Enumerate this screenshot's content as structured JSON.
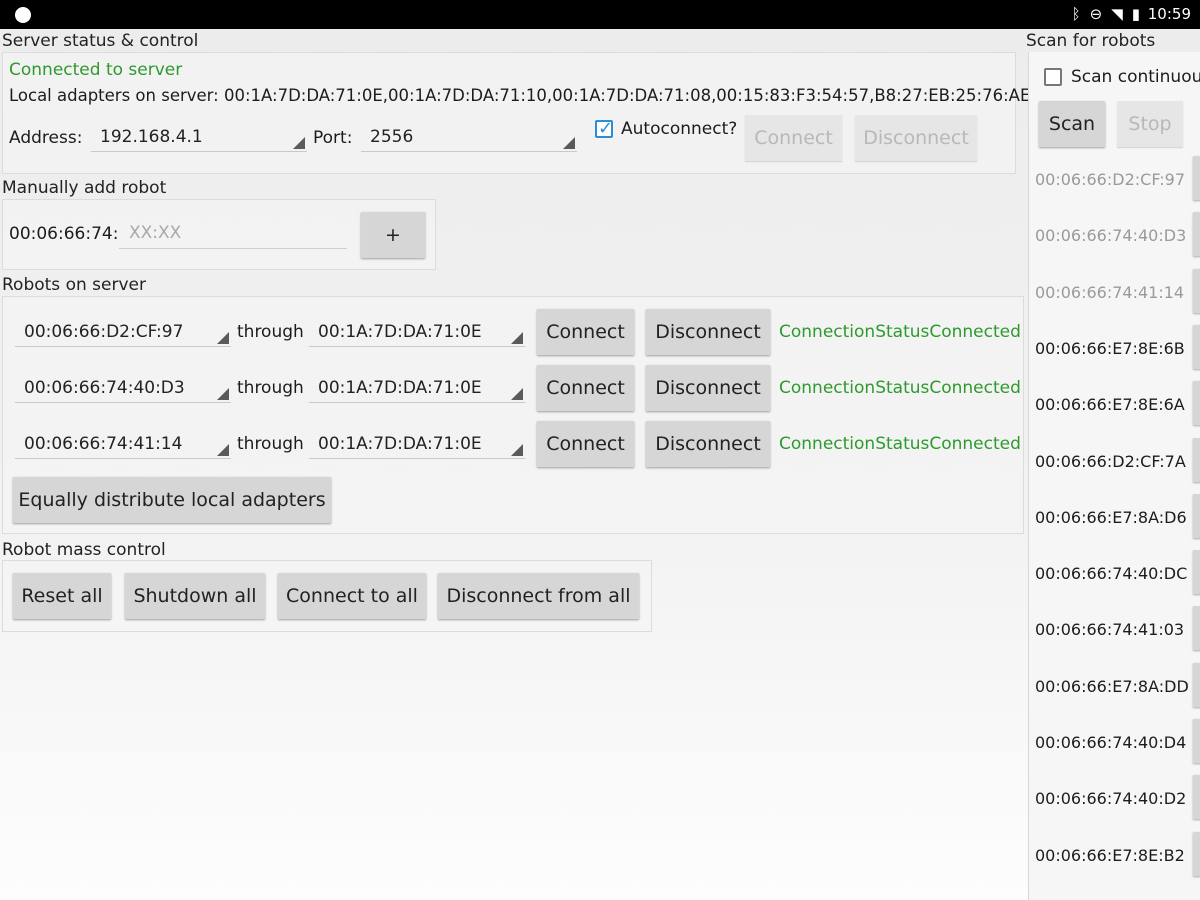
{
  "status_bar": {
    "time": "10:59"
  },
  "server": {
    "section_title": "Server status & control",
    "connection_state": "Connected to server",
    "local_adapters": "Local adapters on server: 00:1A:7D:DA:71:0E,00:1A:7D:DA:71:10,00:1A:7D:DA:71:08,00:15:83:F3:54:57,B8:27:EB:25:76:AE",
    "address_label": "Address:",
    "address_value": "192.168.4.1",
    "port_label": "Port:",
    "port_value": "2556",
    "autoconnect_label": "Autoconnect?",
    "autoconnect_checked": true,
    "connect_label": "Connect",
    "disconnect_label": "Disconnect"
  },
  "manual_add": {
    "section_title": "Manually add robot",
    "prefix": "00:06:66:74:",
    "placeholder": "XX:XX",
    "add_label": "+"
  },
  "robots": {
    "section_title": "Robots on server",
    "through_label": "through",
    "connect_label": "Connect",
    "disconnect_label": "Disconnect",
    "rows": [
      {
        "robot": "00:06:66:D2:CF:97",
        "adapter": "00:1A:7D:DA:71:0E",
        "status": "ConnectionStatusConnected"
      },
      {
        "robot": "00:06:66:74:40:D3",
        "adapter": "00:1A:7D:DA:71:0E",
        "status": "ConnectionStatusConnected"
      },
      {
        "robot": "00:06:66:74:41:14",
        "adapter": "00:1A:7D:DA:71:0E",
        "status": "ConnectionStatusConnected"
      }
    ],
    "distribute_label": "Equally distribute local adapters"
  },
  "mass_control": {
    "section_title": "Robot mass control",
    "reset_all": "Reset all",
    "shutdown_all": "Shutdown all",
    "connect_all": "Connect to all",
    "disconnect_all": "Disconnect from all"
  },
  "scan": {
    "section_title": "Scan for robots",
    "continuous_label": "Scan continuou",
    "scan_label": "Scan",
    "stop_label": "Stop",
    "items": [
      {
        "address": "00:06:66:D2:CF:97",
        "dim": true
      },
      {
        "address": "00:06:66:74:40:D3",
        "dim": true
      },
      {
        "address": "00:06:66:74:41:14",
        "dim": true
      },
      {
        "address": "00:06:66:E7:8E:6B",
        "dim": false
      },
      {
        "address": "00:06:66:E7:8E:6A",
        "dim": false
      },
      {
        "address": "00:06:66:D2:CF:7A",
        "dim": false
      },
      {
        "address": "00:06:66:E7:8A:D6",
        "dim": false
      },
      {
        "address": "00:06:66:74:40:DC",
        "dim": false
      },
      {
        "address": "00:06:66:74:41:03",
        "dim": false
      },
      {
        "address": "00:06:66:E7:8A:DD",
        "dim": false
      },
      {
        "address": "00:06:66:74:40:D4",
        "dim": false
      },
      {
        "address": "00:06:66:74:40:D2",
        "dim": false
      },
      {
        "address": "00:06:66:E7:8E:B2",
        "dim": false
      }
    ]
  },
  "colors": {
    "connected_green": "#2e9a2e",
    "checkbox_blue": "#2a8fd6",
    "button_gray": "#d6d6d6"
  }
}
